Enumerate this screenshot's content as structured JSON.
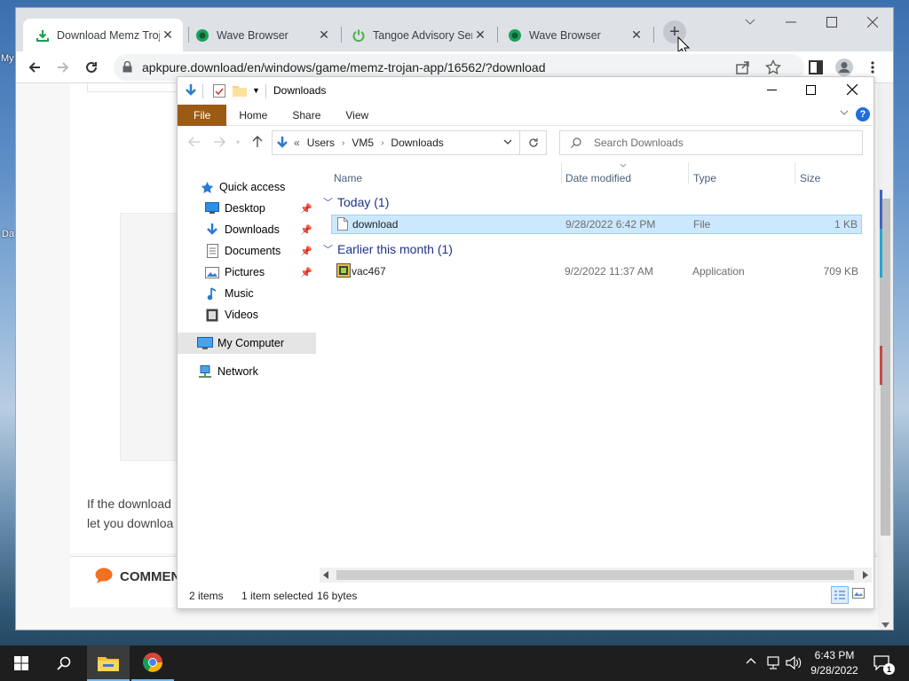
{
  "desktop": {
    "glyph_my": "My",
    "glyph_da": "Da"
  },
  "browser": {
    "tabs": [
      {
        "title": "Download Memz Troj",
        "icon": "download-arrow-icon",
        "active": true
      },
      {
        "title": "Wave Browser",
        "icon": "wave-icon",
        "active": false
      },
      {
        "title": "Tangoe Advisory Serv",
        "icon": "power-icon",
        "active": false
      },
      {
        "title": "Wave Browser",
        "icon": "wave-icon",
        "active": false
      }
    ],
    "url": "apkpure.download/en/windows/game/memz-trojan-app/16562/?download",
    "page_text_line1": "If the download",
    "page_text_line2": "let you downloa",
    "comments_label": "COMMEN"
  },
  "explorer": {
    "title": "Downloads",
    "ribbon": [
      "File",
      "Home",
      "Share",
      "View"
    ],
    "path": [
      "Users",
      "VM5",
      "Downloads"
    ],
    "path_prefix": "«",
    "search_placeholder": "Search Downloads",
    "nav": {
      "quick_access": "Quick access",
      "items": [
        {
          "label": "Desktop",
          "icon": "desktop-icon",
          "pinned": true
        },
        {
          "label": "Downloads",
          "icon": "downloads-icon",
          "pinned": true
        },
        {
          "label": "Documents",
          "icon": "documents-icon",
          "pinned": true
        },
        {
          "label": "Pictures",
          "icon": "pictures-icon",
          "pinned": true
        },
        {
          "label": "Music",
          "icon": "music-icon",
          "pinned": false
        },
        {
          "label": "Videos",
          "icon": "videos-icon",
          "pinned": false
        }
      ],
      "my_computer": "My Computer",
      "network": "Network"
    },
    "columns": [
      "Name",
      "Date modified",
      "Type",
      "Size"
    ],
    "groups": [
      {
        "label": "Today (1)",
        "files": [
          {
            "name": "download",
            "date": "9/28/2022 6:42 PM",
            "type": "File",
            "size": "1 KB",
            "selected": true
          }
        ]
      },
      {
        "label": "Earlier this month (1)",
        "files": [
          {
            "name": "vac467",
            "date": "9/2/2022 11:37 AM",
            "type": "Application",
            "size": "709 KB",
            "selected": false
          }
        ]
      }
    ],
    "status": {
      "items": "2 items",
      "selected": "1 item selected",
      "bytes": "16 bytes"
    }
  },
  "taskbar": {
    "time": "6:43 PM",
    "date": "9/28/2022",
    "notifications": "1"
  },
  "colors": {
    "selection": "#cce8ff",
    "file_tab": "#9c5b15",
    "group_heading": "#1e3287",
    "taskbar": "#1e1e1e"
  }
}
